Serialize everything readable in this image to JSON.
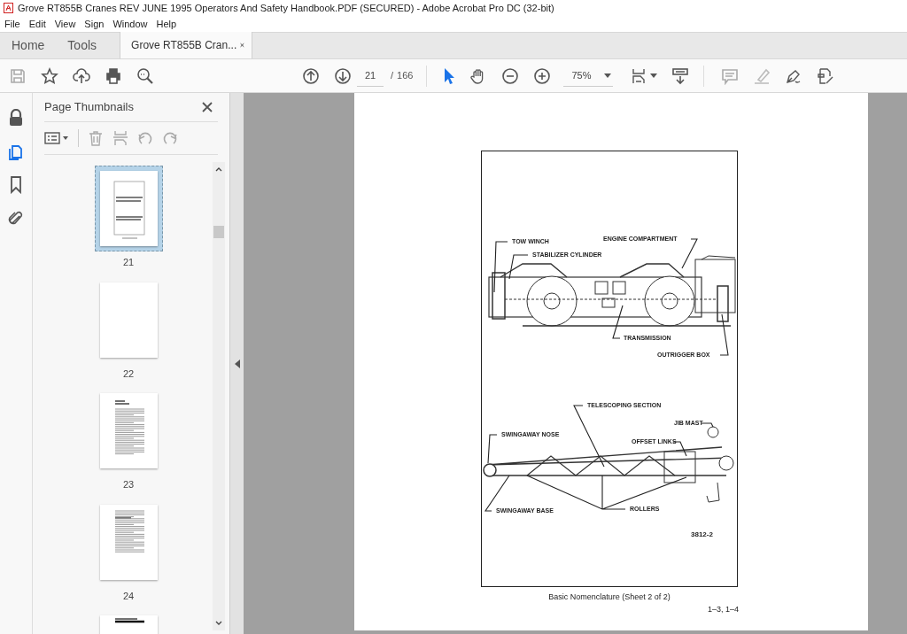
{
  "window": {
    "title": "Grove RT855B Cranes REV JUNE 1995 Operators And Safety Handbook.PDF (SECURED) - Adobe Acrobat Pro DC (32-bit)"
  },
  "menu": [
    "File",
    "Edit",
    "View",
    "Sign",
    "Window",
    "Help"
  ],
  "tabs": [
    {
      "label": "Home",
      "selected": false
    },
    {
      "label": "Tools",
      "selected": false
    },
    {
      "label": "Grove RT855B Cran...",
      "selected": true
    }
  ],
  "toolbar": {
    "page": "21",
    "page_separator": "/",
    "page_total": "166",
    "zoom": "75%"
  },
  "sidebar": {
    "title": "Page Thumbnails",
    "thumbnails": [
      {
        "label": "21",
        "kind": "drawing",
        "selected": true
      },
      {
        "label": "22",
        "kind": "blank",
        "selected": false
      },
      {
        "label": "23",
        "kind": "text",
        "selected": false
      },
      {
        "label": "24",
        "kind": "short",
        "selected": false
      },
      {
        "kind": "heading",
        "selected": false
      }
    ]
  },
  "document": {
    "callouts": [
      {
        "label": "TOW WINCH"
      },
      {
        "label": "STABILIZER CYLINDER"
      },
      {
        "label": "ENGINE COMPARTMENT"
      },
      {
        "label": "TRANSMISSION"
      },
      {
        "label": "OUTRIGGER BOX"
      },
      {
        "label": "TELESCOPING SECTION"
      },
      {
        "label": "JIB MAST"
      },
      {
        "label": "SWINGAWAY NOSE"
      },
      {
        "label": "OFFSET LINKS"
      },
      {
        "label": "SWINGAWAY BASE"
      },
      {
        "label": "ROLLERS"
      }
    ],
    "figure_number": "3812-2",
    "caption": "Basic Nomenclature (Sheet 2 of 2)",
    "page_ref": "1–3, 1–4"
  }
}
